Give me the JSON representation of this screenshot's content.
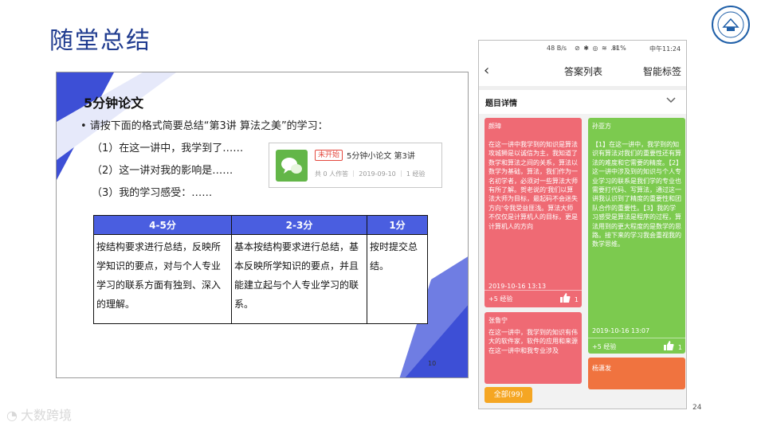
{
  "slide": {
    "title": "随堂总结",
    "page_number": "24"
  },
  "inner_slide": {
    "heading": "5分钟论文",
    "line1": "• 请按下面的格式简要总结“第3讲 算法之美”的学习：",
    "line2": "（1）在这一讲中，我学到了……",
    "line3": "（2）这一讲对我的影响是……",
    "line4": "（3）我的学习感受：……",
    "page_number": "10",
    "task_card": {
      "status": "未开始",
      "title": "5分钟小论文 第3讲",
      "meta": "共 0 人作答 ｜ 2019-09-10 ｜ 1 经验",
      "icon": "chat-bubbles-icon"
    },
    "rubric": {
      "headers": [
        "4-5分",
        "2-3分",
        "1分"
      ],
      "cells": [
        "按结构要求进行总结，反映所学知识的要点，对与个人专业学习的联系方面有独到、深入的理解。",
        "基本按结构要求进行总结，基本反映所学知识的要点，并且能建立起与个人专业学习的联系。",
        "按时提交总结。"
      ]
    }
  },
  "phone": {
    "status": {
      "network": "48 B/s",
      "icons": "⊘ ✱ ◎ ≋ .ıl",
      "battery": "81%",
      "time": "中午11:24"
    },
    "back_icon": "‹",
    "title": "答案列表",
    "smart_tag": "智能标签",
    "section_label": "题目详情",
    "cards": [
      {
        "name": "颜璋",
        "text": "在这一讲中我学到的知识是算法攻城狮是以诚信为主，我知道了数学和算法之间的关系，算法以数学为基础，算法，我们作为一名初学者，必须对一些算法大师有所了解。贺老说的'我们以算法大师为目标，最起码不会迷失方向'令我受益匪浅。算法大师不仅仅是计算机人的目标，更是计算机人的方向",
        "date": "2019-10-16 13:13",
        "exp": "+5 经验",
        "likes": "1"
      },
      {
        "name": "孙亚方",
        "text": "【1】在这一讲中，我学到的知识有算法对我们的重要性还有算法的难度和它需要的精度。【2】这一讲中涉及到的知识与个人专业学习的联系是我们学的专业也需要打代码、写算法，通过这一讲我认识到了精度的重要性和团队合作的重要性。【3】我的学习感受是算法是程序的过程，算法用到的更大程度的是数学的思路。接下来的学习我会重视我的数学思维。",
        "date": "2019-10-16 13:07",
        "exp": "+5 经验",
        "likes": "1"
      },
      {
        "name": "张鲁宁",
        "text": "在这一讲中，我学到的知识有伟大的软件家，软件的应用和来源 在这一讲中和我专业涉及"
      },
      {
        "name": "杨潇发"
      }
    ],
    "all_button": "全部(99)"
  },
  "watermark": "大数跨境",
  "colors": {
    "title_blue": "#1f3b8f",
    "table_header": "#4a5ee0",
    "card_red": "#ef6a74",
    "card_green": "#7cca4f",
    "card_orange": "#f0733f",
    "button_orange": "#f5a623"
  }
}
